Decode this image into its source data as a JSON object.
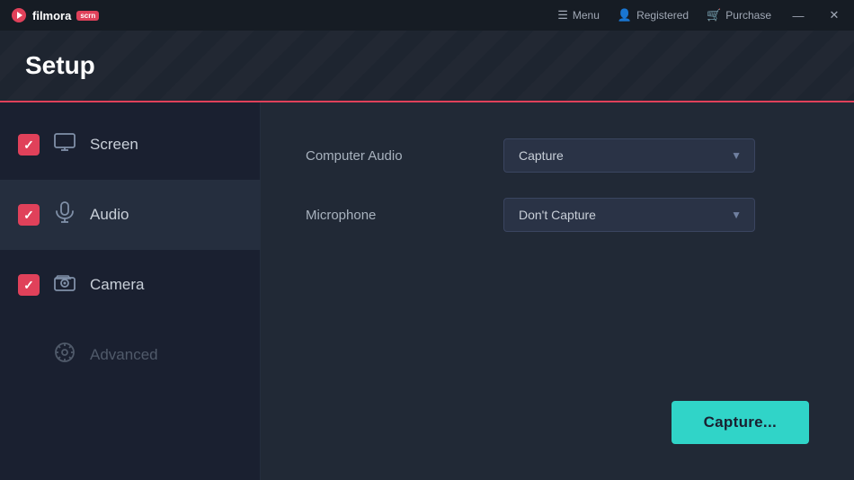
{
  "titlebar": {
    "logo": "filmora scrn",
    "logo_badge": "scrn",
    "logo_main": "filmora",
    "menu_label": "Menu",
    "registered_label": "Registered",
    "purchase_label": "Purchase",
    "minimize_label": "—",
    "close_label": "✕"
  },
  "header": {
    "title": "Setup"
  },
  "sidebar": {
    "items": [
      {
        "id": "screen",
        "label": "Screen",
        "checked": true,
        "active": false,
        "disabled": false
      },
      {
        "id": "audio",
        "label": "Audio",
        "checked": true,
        "active": true,
        "disabled": false
      },
      {
        "id": "camera",
        "label": "Camera",
        "checked": true,
        "active": false,
        "disabled": false
      },
      {
        "id": "advanced",
        "label": "Advanced",
        "checked": false,
        "active": false,
        "disabled": true
      }
    ]
  },
  "content": {
    "computer_audio_label": "Computer Audio",
    "computer_audio_value": "Capture",
    "microphone_label": "Microphone",
    "microphone_value": "Don't Capture",
    "capture_button": "Capture..."
  }
}
